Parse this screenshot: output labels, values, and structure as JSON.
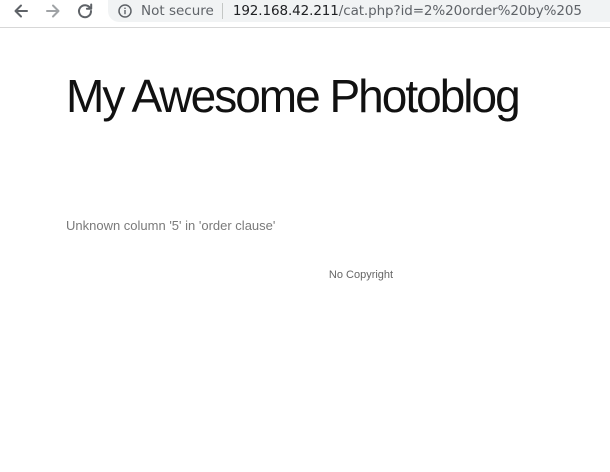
{
  "browser": {
    "back_icon": "arrow-left-icon",
    "forward_icon": "arrow-right-icon",
    "reload_icon": "reload-icon",
    "security_icon": "info-icon",
    "security_label": "Not secure",
    "url_host": "192.168.42.211",
    "url_path": "/cat.php?id=2%20order%20by%205"
  },
  "page": {
    "title": "My Awesome Photoblog",
    "error_message": "Unknown column '5' in 'order clause'",
    "footer": "No Copyright"
  },
  "colors": {
    "title": "#111111",
    "error_text": "#7a7a7a",
    "footer_text": "#666666",
    "omnibox_bg": "#f1f3f4"
  }
}
